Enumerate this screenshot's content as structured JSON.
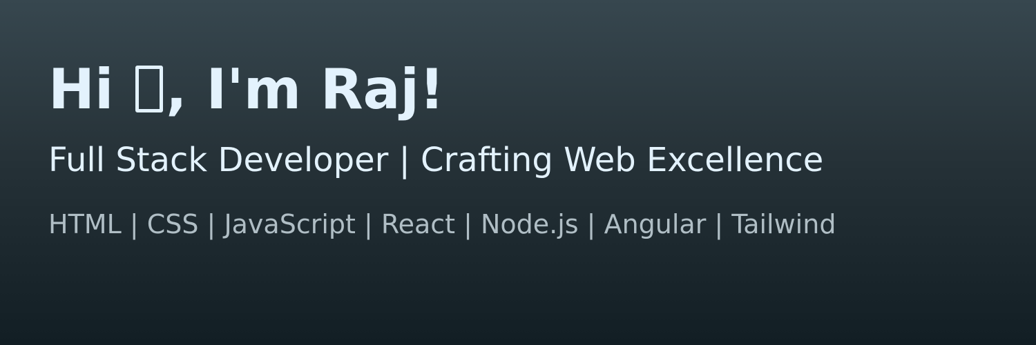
{
  "header": {
    "greeting_prefix": "Hi ",
    "greeting_emoji": "waving-hand-icon",
    "greeting_suffix": ", I'm Raj!",
    "tagline": "Full Stack Developer | Crafting Web Excellence",
    "tech_stack": "HTML | CSS | JavaScript | React | Node.js | Angular | Tailwind"
  },
  "colors": {
    "background_top": "#37474f",
    "background_bottom": "#121e24",
    "heading": "#e3f2fd",
    "muted": "#b0bec5"
  }
}
